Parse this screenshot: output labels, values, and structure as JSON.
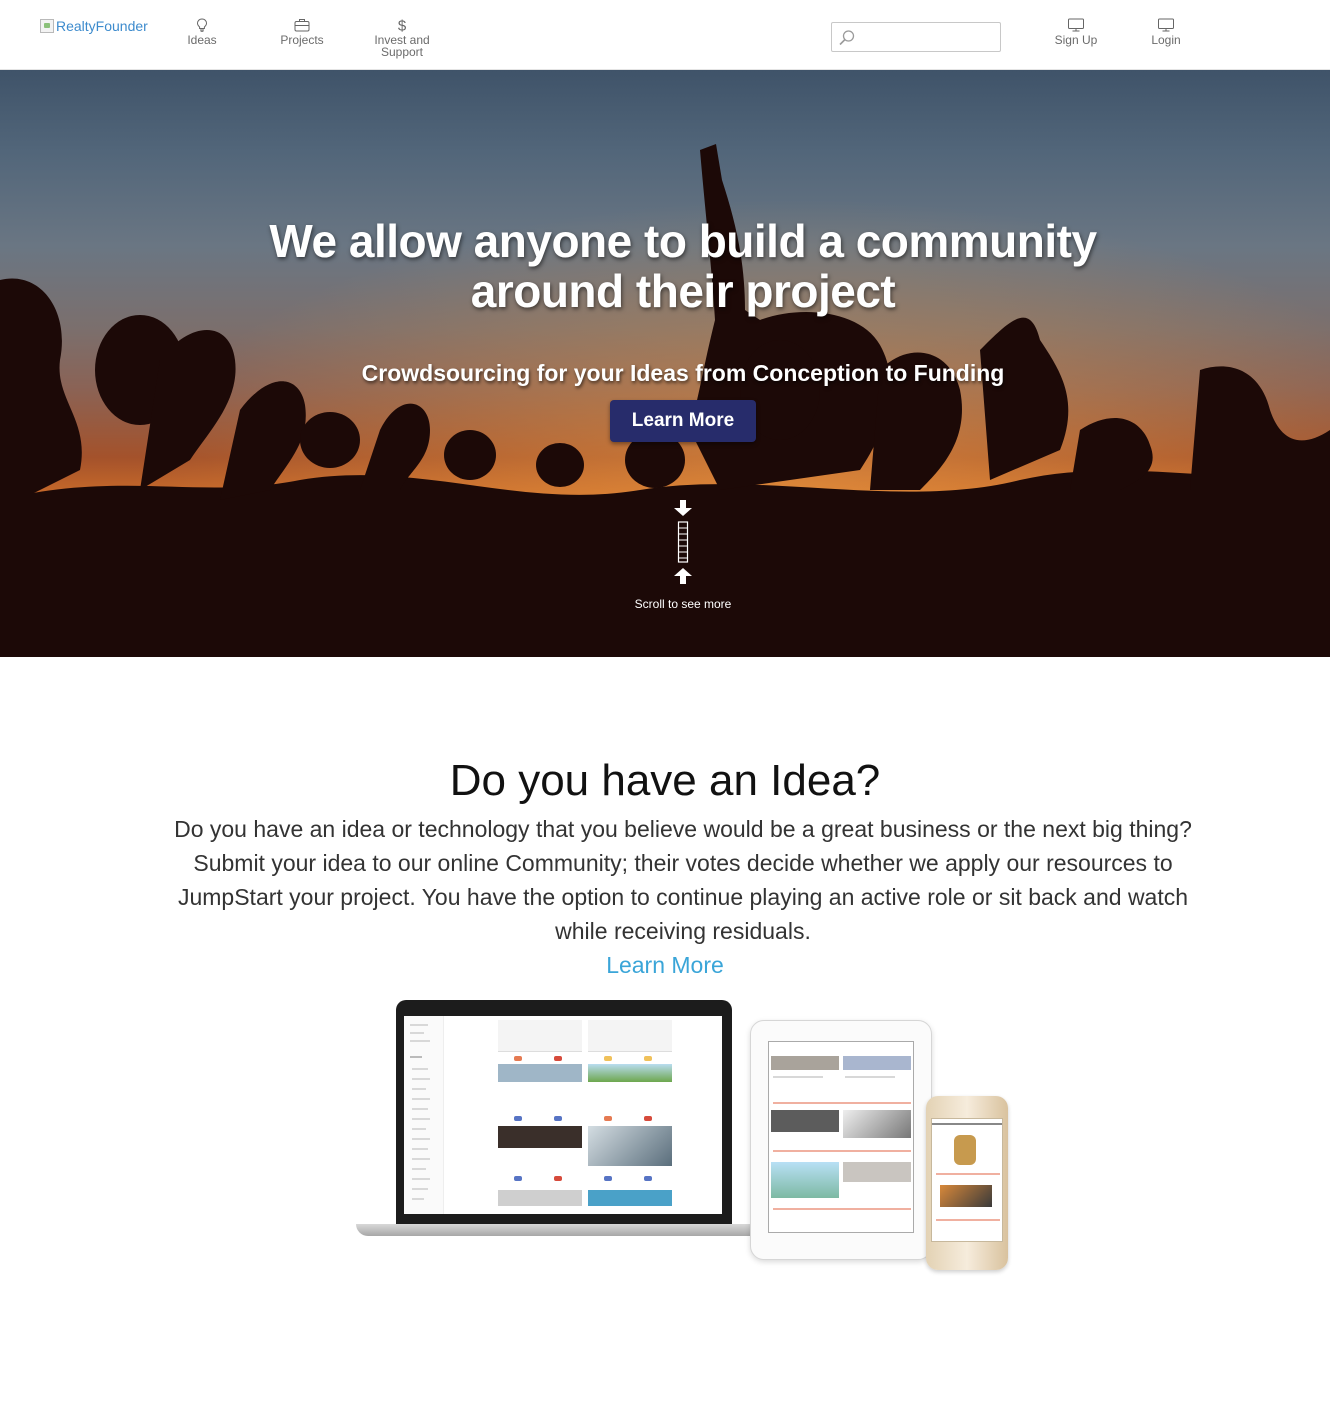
{
  "nav": {
    "logo_alt": "RealtyFounder",
    "items": [
      {
        "label": "Ideas",
        "icon": "lightbulb-icon"
      },
      {
        "label": "Projects",
        "icon": "briefcase-icon"
      },
      {
        "label": "Invest and Support",
        "icon": "dollar-icon"
      }
    ],
    "search": {
      "placeholder": "",
      "value": ""
    },
    "signup": {
      "label": "Sign Up",
      "icon": "monitor-icon"
    },
    "login": {
      "label": "Login",
      "icon": "monitor-icon"
    }
  },
  "hero": {
    "title": "We allow anyone to build a community around their project",
    "subtitle": "Crowdsourcing for your Ideas from Conception to Funding",
    "button_label": "Learn More",
    "scroll_text": "Scroll to see more",
    "button_color": "#272c6b"
  },
  "idea_section": {
    "title": "Do you have an Idea?",
    "body": "Do you have an idea or technology that you believe would be a great business or the next big thing? Submit your idea to our online Community; their votes decide whether we apply our resources to JumpStart your project. You have the option to continue playing an active role or sit back and watch while receiving residuals.",
    "link_label": "Learn More",
    "link_color": "#3aa5d8"
  }
}
